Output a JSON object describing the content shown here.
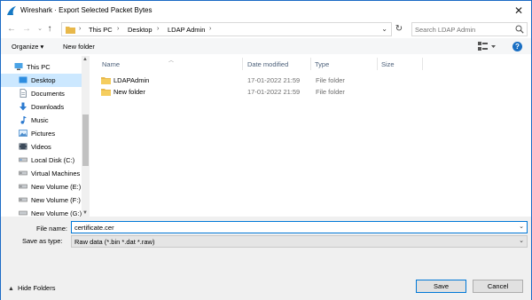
{
  "window": {
    "title": "Wireshark · Export Selected Packet Bytes",
    "close_glyph": "✕"
  },
  "address": {
    "crumbs": [
      "This PC",
      "Desktop",
      "LDAP Admin"
    ],
    "separator": "›",
    "search_placeholder": "Search LDAP Admin"
  },
  "toolbar": {
    "organize_label": "Organize ▾",
    "new_folder_label": "New folder",
    "help_label": "?"
  },
  "nav": {
    "items": [
      {
        "label": "This PC",
        "icon": "pc-icon"
      },
      {
        "label": "Desktop",
        "icon": "desktop-icon",
        "selected": true
      },
      {
        "label": "Documents",
        "icon": "documents-icon"
      },
      {
        "label": "Downloads",
        "icon": "downloads-icon"
      },
      {
        "label": "Music",
        "icon": "music-icon"
      },
      {
        "label": "Pictures",
        "icon": "pictures-icon"
      },
      {
        "label": "Videos",
        "icon": "videos-icon"
      },
      {
        "label": "Local Disk (C:)",
        "icon": "drive-icon"
      },
      {
        "label": "Virtual Machines",
        "icon": "drive-icon"
      },
      {
        "label": "New Volume (E:)",
        "icon": "drive-icon"
      },
      {
        "label": "New Volume (F:)",
        "icon": "drive-icon"
      },
      {
        "label": "New Volume (G:)",
        "icon": "drive-icon"
      }
    ]
  },
  "filelist": {
    "columns": {
      "name": "Name",
      "date": "Date modified",
      "type": "Type",
      "size": "Size"
    },
    "rows": [
      {
        "name": "LDAPAdmin",
        "date": "17-01-2022 21:59",
        "type": "File folder"
      },
      {
        "name": "New folder",
        "date": "17-01-2022 21:59",
        "type": "File folder"
      }
    ]
  },
  "form": {
    "file_name_label": "File name:",
    "file_name_value": "certificate.cer",
    "save_as_type_label": "Save as type:",
    "save_as_type_value": "Raw data (*.bin *.dat *.raw)"
  },
  "footer": {
    "hide_folders_label": "Hide Folders",
    "save_label": "Save",
    "cancel_label": "Cancel"
  },
  "colors": {
    "accent": "#0078d7",
    "selection": "#cce8ff",
    "folder": "#e8b84a"
  }
}
